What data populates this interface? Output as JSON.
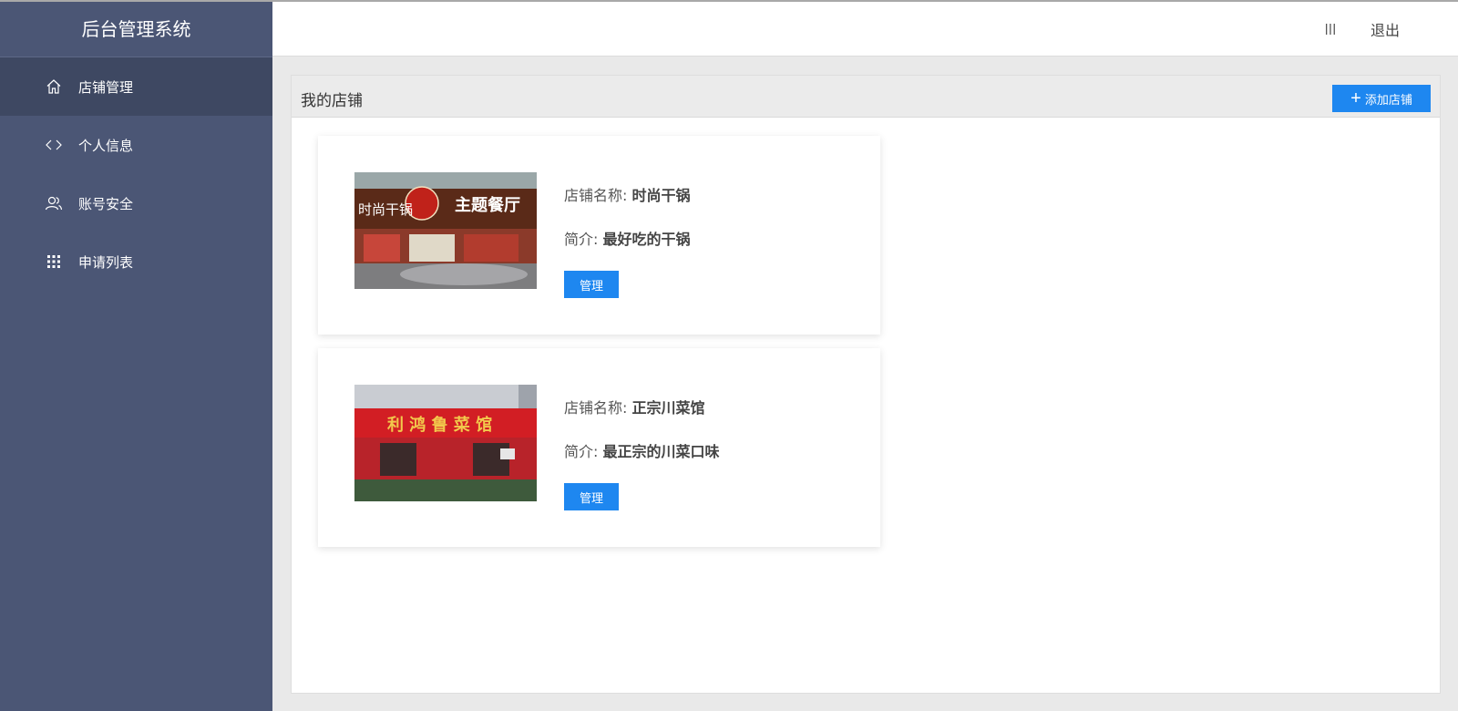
{
  "sidebar": {
    "title": "后台管理系统",
    "items": [
      {
        "label": "店铺管理",
        "icon": "home-icon"
      },
      {
        "label": "个人信息",
        "icon": "code-brackets-icon"
      },
      {
        "label": "账号安全",
        "icon": "users-icon"
      },
      {
        "label": "申请列表",
        "icon": "grid-icon"
      }
    ]
  },
  "header": {
    "menu_icon": "menu-icon",
    "logout_label": "退出"
  },
  "panel": {
    "title": "我的店铺",
    "add_button_label": "添加店铺"
  },
  "stores": [
    {
      "name_label": "店铺名称:",
      "name": "时尚干锅",
      "desc_label": "简介:",
      "desc": "最好吃的干锅",
      "manage_label": "管理",
      "sign_text": "时尚干锅 主题餐厅"
    },
    {
      "name_label": "店铺名称:",
      "name": "正宗川菜馆",
      "desc_label": "简介:",
      "desc": "最正宗的川菜口味",
      "manage_label": "管理",
      "sign_text": "利鸿鲁菜馆"
    }
  ],
  "colors": {
    "sidebar_bg": "#4b5675",
    "sidebar_active": "#3e4862",
    "primary": "#1e87f0"
  }
}
